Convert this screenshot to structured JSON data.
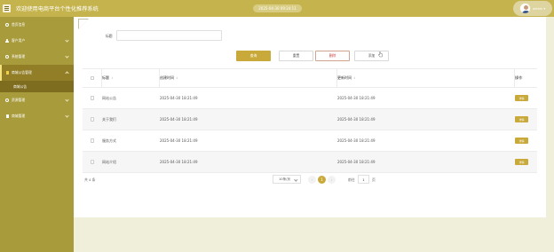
{
  "header": {
    "title": "欢迎使用电商平台个性化推荐系统",
    "datetime": "2025-04-30 09:24:11",
    "username": "admin"
  },
  "sidebar": {
    "items": [
      {
        "label": "首页信息",
        "icon": "gear-icon",
        "has_arrow": false
      },
      {
        "label": "客户用户",
        "icon": "person-icon",
        "has_arrow": true
      },
      {
        "label": "系统管理",
        "icon": "gear-icon",
        "has_arrow": true
      },
      {
        "label": "商城公告管理",
        "icon": "book-icon",
        "has_arrow": true,
        "active": true
      },
      {
        "label": "资源管理",
        "icon": "gear-icon",
        "has_arrow": true
      },
      {
        "label": "商城管理",
        "icon": "book-icon",
        "has_arrow": true
      }
    ],
    "subitem": "商城公告"
  },
  "search": {
    "label": "标题",
    "value": "",
    "placeholder": ""
  },
  "buttons": {
    "search": "查询",
    "reset": "重置",
    "delete": "删除",
    "add": "添加"
  },
  "table": {
    "columns": [
      "标题",
      "创建时间",
      "更新时间",
      "操作"
    ],
    "rows": [
      {
        "title": "网站公告",
        "created": "2025-04-30 18:21:49",
        "updated": "2025-04-30 18:21:49",
        "action": "详情"
      },
      {
        "title": "关于我们",
        "created": "2025-04-30 18:21:49",
        "updated": "2025-04-30 18:21:49",
        "action": "详情"
      },
      {
        "title": "服务方式",
        "created": "2025-04-30 18:21:49",
        "updated": "2025-04-30 18:21:49",
        "action": "详情"
      },
      {
        "title": "网站介绍",
        "created": "2025-04-30 18:21:49",
        "updated": "2025-04-30 18:21:49",
        "action": "详情"
      }
    ]
  },
  "pagination": {
    "total": "共 4 条",
    "page_size": "10条/页",
    "current_page": "1",
    "prev": "‹",
    "next": "›",
    "goto_prefix": "前往",
    "goto_value": "1",
    "goto_suffix": "页"
  },
  "colors": {
    "header": "#c5b44e",
    "sidebar": "#a89b3b",
    "accent": "#c9a93a",
    "content_bg": "#f0efda"
  }
}
